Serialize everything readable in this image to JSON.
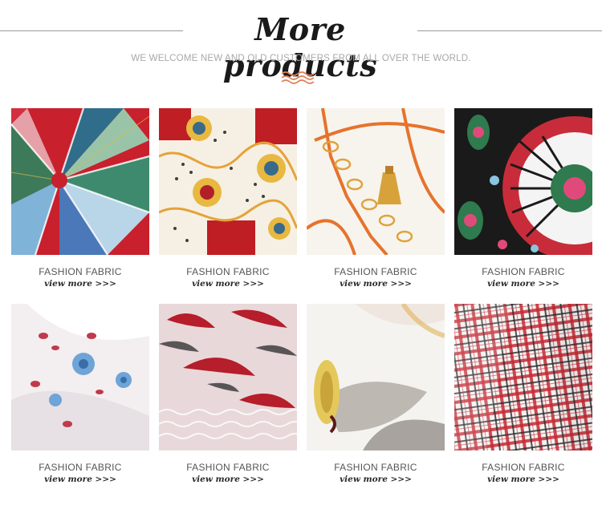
{
  "header": {
    "title": "More products",
    "subtitle": "WE WELCOME NEW AND OLD CUSTOMERS FROM ALL OVER THE WORLD."
  },
  "colors": {
    "accent": "#e07f57",
    "title": "#1a1a1a",
    "subtitle": "#a8a8a8"
  },
  "icons": {
    "divider": "wave-ornament-icon"
  },
  "products": [
    {
      "label": "FASHION FABRIC",
      "more": "view more >>>",
      "pattern": "geometric-kaleidoscope-print"
    },
    {
      "label": "FASHION FABRIC",
      "more": "view more >>>",
      "pattern": "baroque-leopard-print"
    },
    {
      "label": "FASHION FABRIC",
      "more": "view more >>>",
      "pattern": "chain-tassel-print"
    },
    {
      "label": "FASHION FABRIC",
      "more": "view more >>>",
      "pattern": "mandala-print"
    },
    {
      "label": "FASHION FABRIC",
      "more": "view more >>>",
      "pattern": "floral-chiffon-print"
    },
    {
      "label": "FASHION FABRIC",
      "more": "view more >>>",
      "pattern": "leaf-zebra-print"
    },
    {
      "label": "FASHION FABRIC",
      "more": "view more >>>",
      "pattern": "painted-flower-print"
    },
    {
      "label": "FASHION FABRIC",
      "more": "view more >>>",
      "pattern": "gingham-plaid"
    }
  ]
}
